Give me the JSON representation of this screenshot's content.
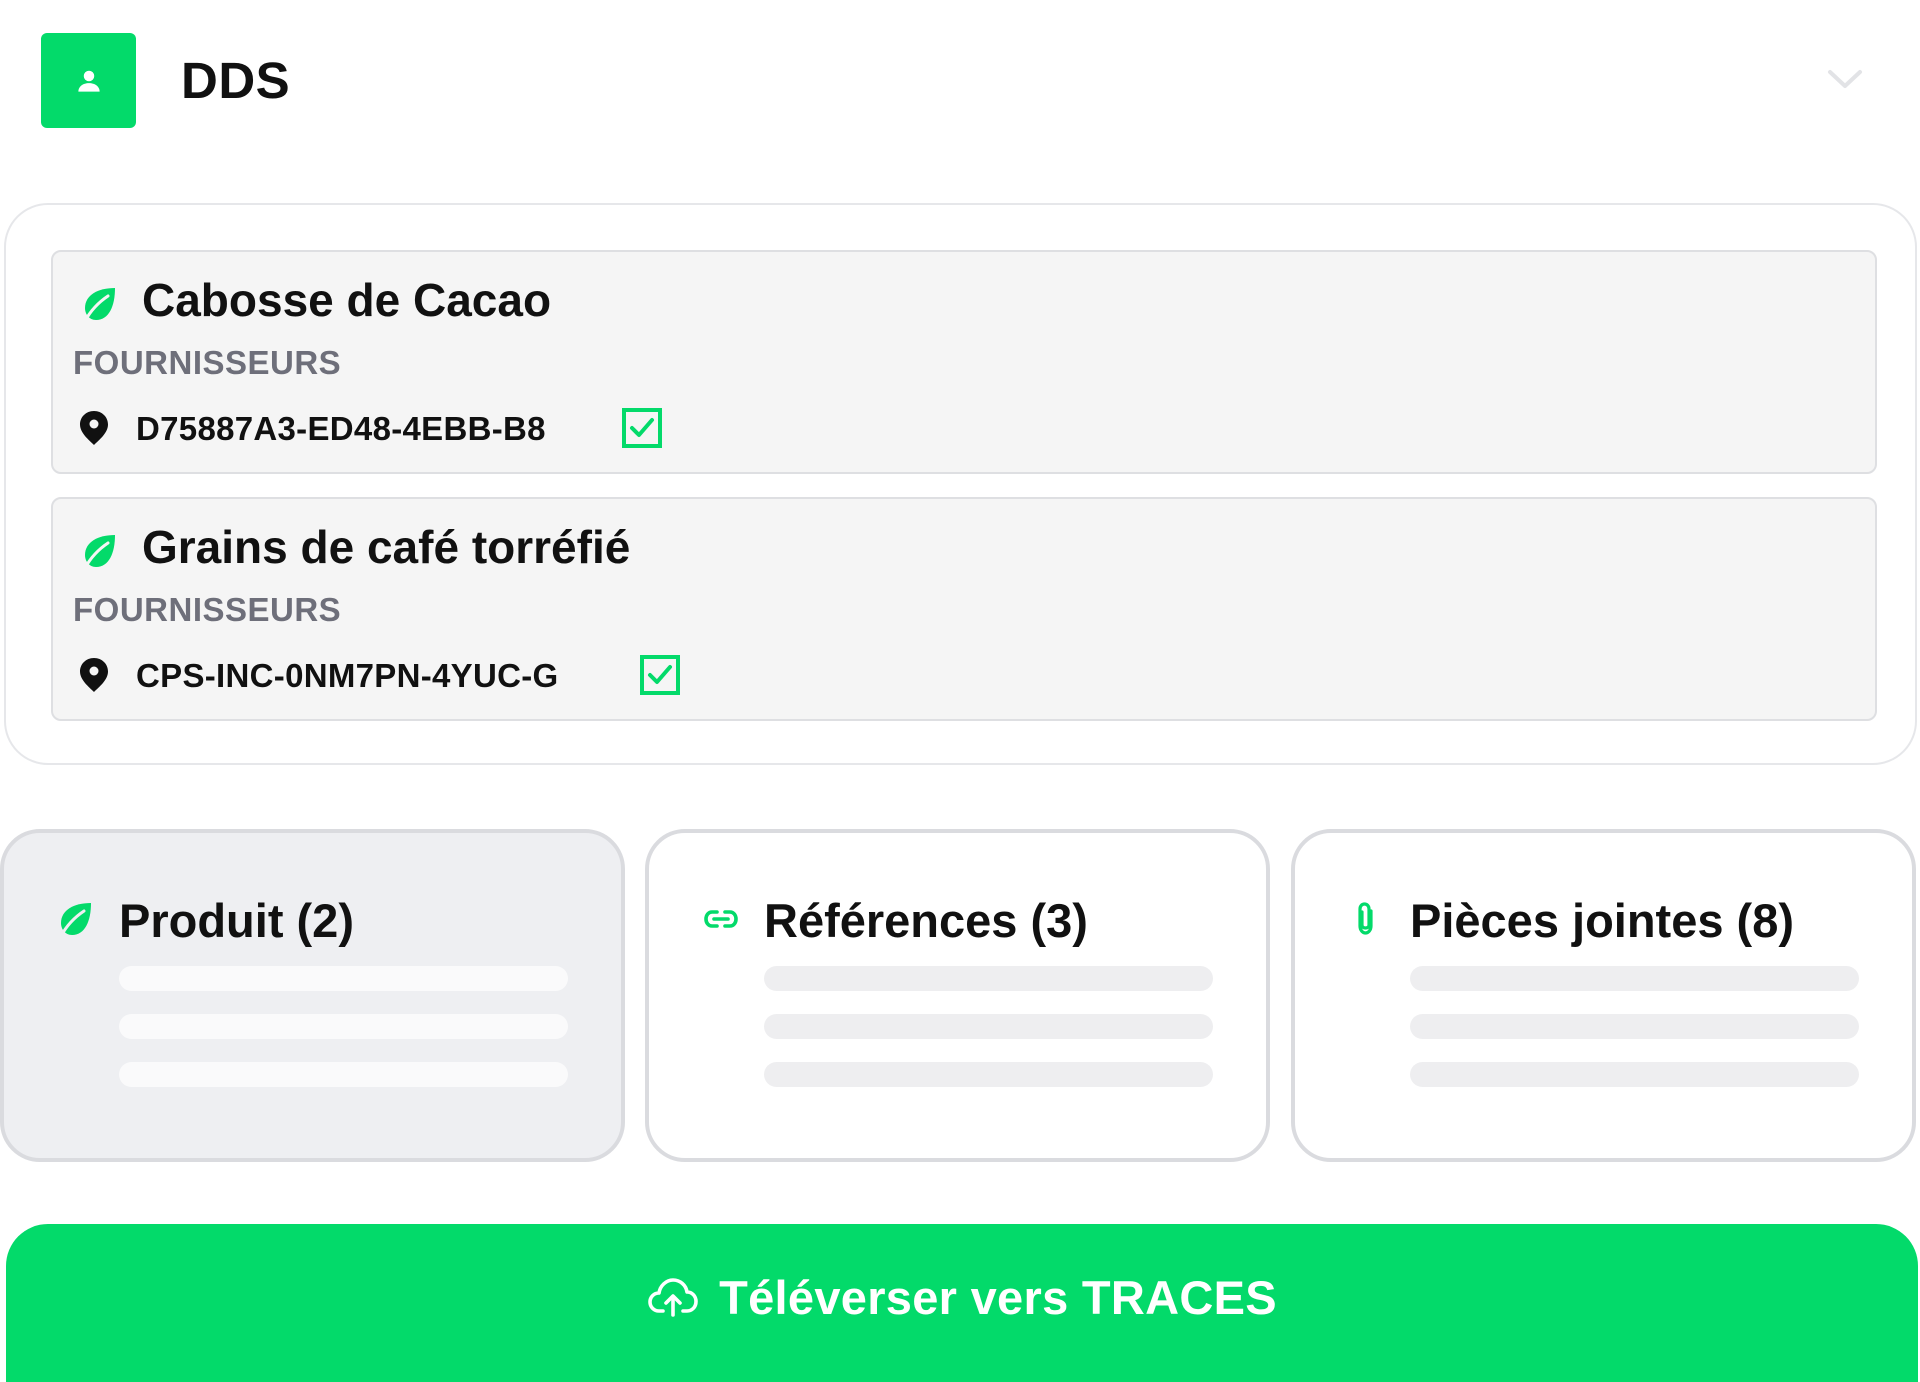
{
  "header": {
    "title": "DDS",
    "avatar_icon": "user-icon",
    "toggle_icon": "chevron-down-icon"
  },
  "products": [
    {
      "name": "Cabosse de Cacao",
      "icon": "leaf-icon",
      "suppliers_label": "FOURNISSEURS",
      "supplier_icon": "map-pin-icon",
      "supplier_id": "D75887A3-ED48-4EBB-B8",
      "checked": true
    },
    {
      "name": "Grains de café torréfié",
      "icon": "leaf-icon",
      "suppliers_label": "FOURNISSEURS",
      "supplier_icon": "map-pin-icon",
      "supplier_id": "CPS-INC-0NM7PN-4YUC-G",
      "checked": true
    }
  ],
  "summary": [
    {
      "title": "Produit (2)",
      "icon": "leaf-icon",
      "selected": true
    },
    {
      "title": "Références (3)",
      "icon": "link-icon",
      "selected": false
    },
    {
      "title": "Pièces jointes (8)",
      "icon": "paperclip-icon",
      "selected": false
    }
  ],
  "upload": {
    "label": "Téléverser vers TRACES",
    "icon": "cloud-upload-icon"
  },
  "colors": {
    "accent": "#03DA6A",
    "card_bg": "#F5F5F5",
    "selected_bg": "#EEEFF2",
    "muted_text": "#6E6F7A"
  }
}
